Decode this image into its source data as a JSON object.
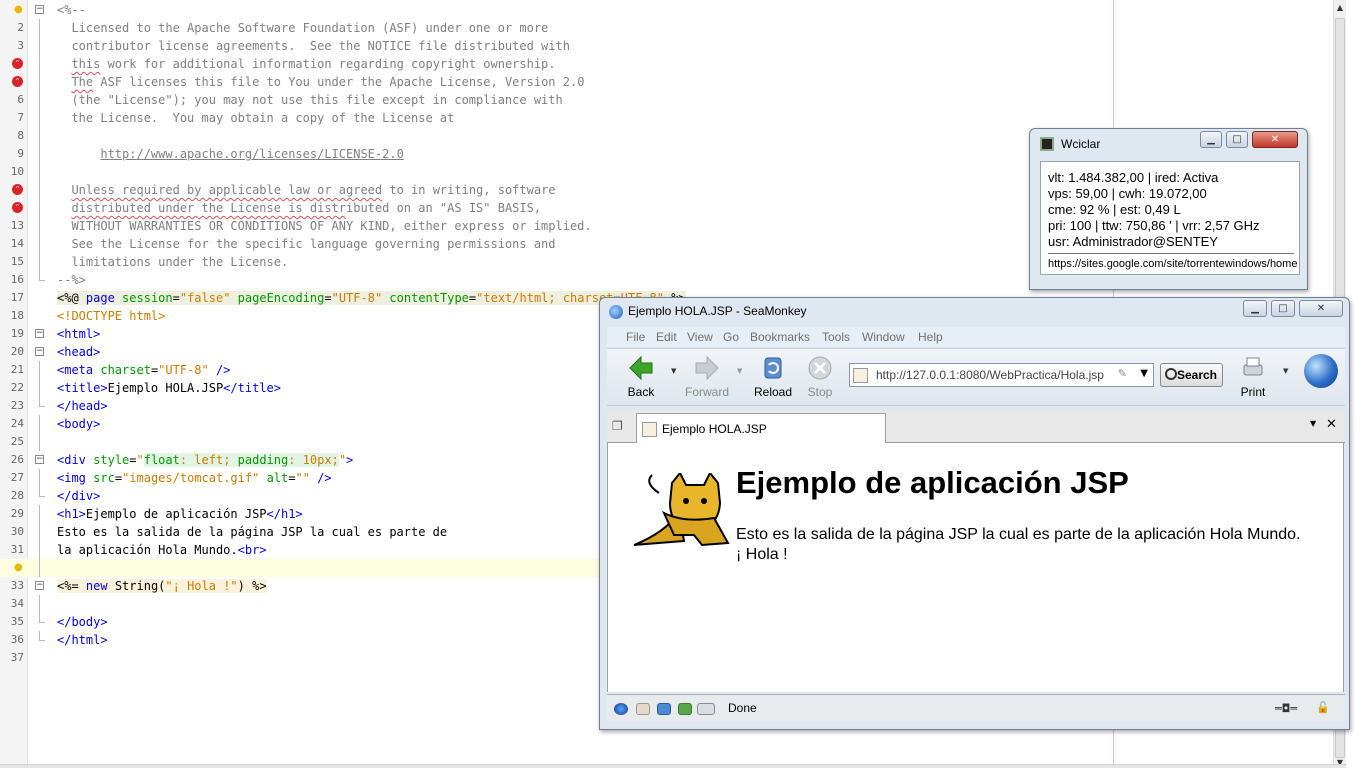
{
  "editor": {
    "lines": [
      {
        "n": "1",
        "html": "<span class=\"cm\">&lt;%--</span>"
      },
      {
        "n": "2",
        "html": "<span class=\"cm\">  Licensed to the Apache Software Foundation (ASF) under one or more</span>"
      },
      {
        "n": "3",
        "html": "<span class=\"cm\">  contributor license agreements.  See the NOTICE file distributed with</span>"
      },
      {
        "n": "4",
        "html": "<span class=\"cm\">  <span class=\"sq\">this</span> work for additional information regarding copyright ownership.</span>"
      },
      {
        "n": "5",
        "html": "<span class=\"cm\">  <span class=\"sq\">The</span> ASF licenses this file to You under the Apache License, Version 2.0</span>"
      },
      {
        "n": "6",
        "html": "<span class=\"cm\">  (the \"License\"); you may not use this file except in compliance with</span>"
      },
      {
        "n": "7",
        "html": "<span class=\"cm\">  the License.  You may obtain a copy of the License at</span>"
      },
      {
        "n": "8",
        "html": ""
      },
      {
        "n": "9",
        "html": "<span class=\"cm\">      <span class=\"url\">http://www.apache.org/licenses/LICENSE-2.0</span></span>"
      },
      {
        "n": "10",
        "html": ""
      },
      {
        "n": "11",
        "html": "<span class=\"cm\">  <span class=\"sq\">Unless required by applicable law or agreed</span> to in writing, software</span>"
      },
      {
        "n": "12",
        "html": "<span class=\"cm\">  <span class=\"sq\">distributed under the License is distr</span>ibuted on an \"AS IS\" BASIS,</span>"
      },
      {
        "n": "13",
        "html": "<span class=\"cm\">  WITHOUT WARRANTIES OR CONDITIONS OF ANY KIND, either express or implied.</span>"
      },
      {
        "n": "14",
        "html": "<span class=\"cm\">  See the License for the specific language governing permissions and</span>"
      },
      {
        "n": "15",
        "html": "<span class=\"cm\">  limitations under the License.</span>"
      },
      {
        "n": "16",
        "html": "<span class=\"cm\">--%&gt;</span>"
      },
      {
        "n": "17",
        "html": "<span class=\"dir\">&lt;%@ <span class=\"kw\">page</span> <span class=\"at\">session</span>=<span class=\"av\">\"false\"</span> <span class=\"at\">pageEncoding</span>=<span class=\"av\">\"UTF-8\"</span> <span class=\"at\">contentType</span>=<span class=\"av\">\"text/html; charset=UTF-8\"</span> %&gt;</span>"
      },
      {
        "n": "18",
        "html": "<span class=\"av\">&lt;!DOCTYPE html&gt;</span>"
      },
      {
        "n": "19",
        "html": "<span class=\"tg\">&lt;html&gt;</span>"
      },
      {
        "n": "20",
        "html": "<span class=\"tg\">&lt;head&gt;</span>"
      },
      {
        "n": "21",
        "html": "<span class=\"tg\">&lt;meta</span> <span class=\"at\">charset</span>=<span class=\"av\">\"UTF-8\"</span> <span class=\"tg\">/&gt;</span>"
      },
      {
        "n": "22",
        "html": "<span class=\"tg\">&lt;title&gt;</span>Ejemplo HOLA.JSP<span class=\"tg\">&lt;/title&gt;</span>"
      },
      {
        "n": "23",
        "html": "<span class=\"tg\">&lt;/head&gt;</span>"
      },
      {
        "n": "24",
        "html": "<span class=\"tg\">&lt;body&gt;</span>"
      },
      {
        "n": "25",
        "html": ""
      },
      {
        "n": "26",
        "html": "<span class=\"tg\">&lt;div</span> <span class=\"at\">style</span>=<span class=\"av\">\"<span class=\"cs\"><span class=\"at\">float</span>: left; <span class=\"at\">padding</span>: 10px;</span>\"</span><span class=\"tg\">&gt;</span>"
      },
      {
        "n": "27",
        "html": "<span class=\"tg\">&lt;img</span> <span class=\"at\">src</span>=<span class=\"av\">\"images/tomcat.gif\"</span> <span class=\"at\">alt</span>=<span class=\"av\">\"\"</span> <span class=\"tg\">/&gt;</span>"
      },
      {
        "n": "28",
        "html": "<span class=\"tg\">&lt;/div&gt;</span>"
      },
      {
        "n": "29",
        "html": "<span class=\"tg\">&lt;h1&gt;</span>Ejemplo de aplicación JSP<span class=\"tg\">&lt;/h1&gt;</span>"
      },
      {
        "n": "30",
        "html": "Esto es la salida de la página JSP la cual es parte de"
      },
      {
        "n": "31",
        "html": "la aplicación Hola Mundo.<span class=\"tg\">&lt;br&gt;</span>"
      },
      {
        "n": "32",
        "html": ""
      },
      {
        "n": "33",
        "html": "<span class=\"jsx\">&lt;%= <span class=\"kw\">new</span> String(<span class=\"av\">\"¡ Hola !\"</span>) %&gt;</span>"
      },
      {
        "n": "34",
        "html": ""
      },
      {
        "n": "35",
        "html": "<span class=\"tg\">&lt;/body&gt;</span>"
      },
      {
        "n": "36",
        "html": "<span class=\"tg\">&lt;/html&gt;</span>"
      },
      {
        "n": "37",
        "html": ""
      }
    ]
  },
  "wciclar": {
    "title": "Wciclar",
    "line1": "vlt: 1.484.382,00 | ired: Activa",
    "line2": "vps: 59,00 | cwh: 19.072,00",
    "line3": "cme: 92 % | est: 0,49 L",
    "line4": "pri: 100 | ttw: 750,86 ' | vrr: 2,57 GHz",
    "line5": "usr: Administrador@SENTEY",
    "link": "https://sites.google.com/site/torrentewindows/home"
  },
  "browser": {
    "title": "Ejemplo HOLA.JSP - SeaMonkey",
    "menu": {
      "file": "File",
      "edit": "Edit",
      "view": "View",
      "go": "Go",
      "bookmarks": "Bookmarks",
      "tools": "Tools",
      "window": "Window",
      "help": "Help"
    },
    "nav": {
      "back": "Back",
      "forward": "Forward",
      "reload": "Reload",
      "stop": "Stop",
      "print": "Print",
      "search": "Search"
    },
    "url": "http://127.0.0.1:8080/WebPractica/Hola.jsp",
    "tab_title": "Ejemplo HOLA.JSP",
    "page": {
      "heading": "Ejemplo de aplicación JSP",
      "text": "Esto es la salida de la página JSP la cual es parte de la aplicación Hola Mundo.",
      "hola": "¡ Hola !"
    },
    "status": "Done"
  },
  "colors": {
    "accent": "#0000e6",
    "error": "#d9242b",
    "comment": "#808080"
  }
}
